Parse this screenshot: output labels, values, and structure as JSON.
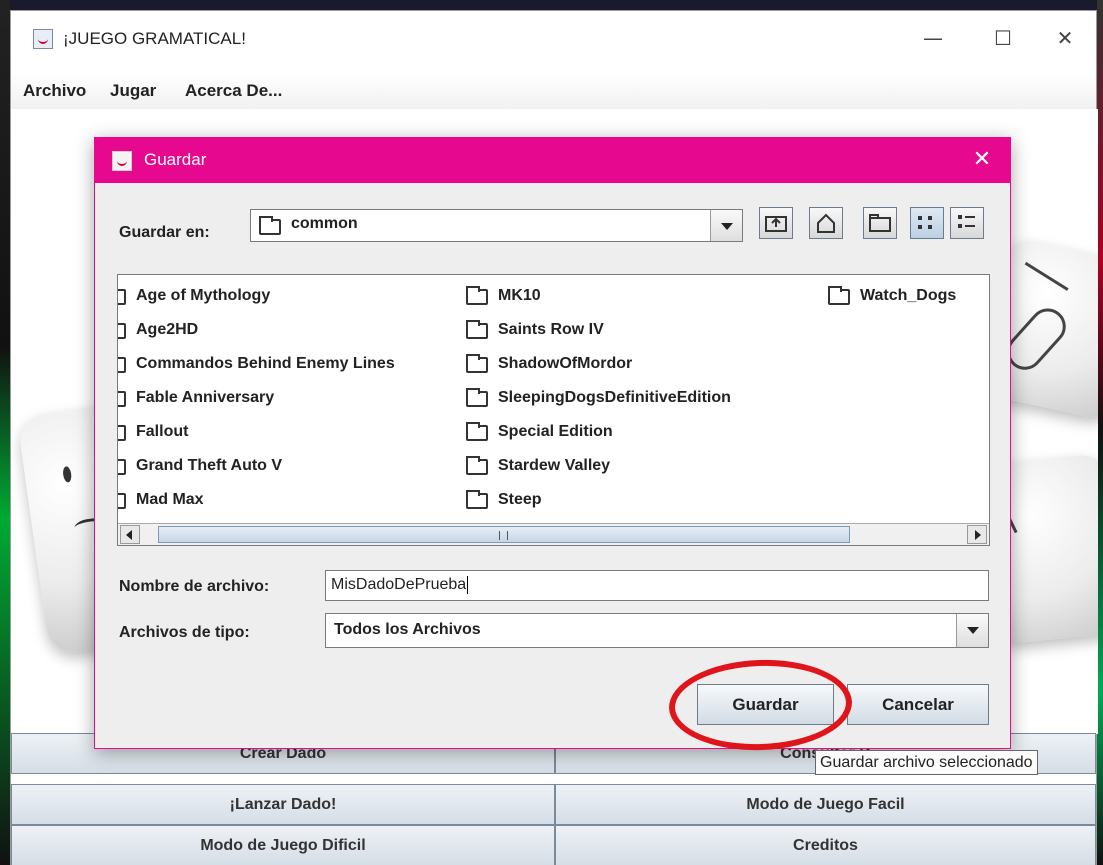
{
  "main_window": {
    "title": "¡JUEGO GRAMATICAL!",
    "controls": {
      "minimize": "—",
      "maximize": "☐",
      "close": "✕"
    },
    "menu": [
      "Archivo",
      "Jugar",
      "Acerca De..."
    ],
    "buttons": {
      "crear_dado": "Crear Dado",
      "consultar_dado": "Consultar D",
      "lanzar_dado": "¡Lanzar Dado!",
      "modo_facil": "Modo de Juego Facil",
      "modo_dificil": "Modo de Juego Dificil",
      "creditos": "Creditos"
    }
  },
  "dialog": {
    "title": "Guardar",
    "close": "✕",
    "look_in_label": "Guardar en:",
    "look_in_value": "common",
    "toolbar_icons": [
      "up-one-level-icon",
      "home-icon",
      "new-folder-icon",
      "list-view-icon",
      "details-view-icon"
    ],
    "files": [
      "Age of Mythology",
      "Age2HD",
      "Commandos Behind Enemy Lines",
      "Fable Anniversary",
      "Fallout",
      "Grand Theft Auto V",
      "Mad Max",
      "MK10",
      "Saints Row IV",
      "ShadowOfMordor",
      "SleepingDogsDefinitiveEdition",
      "Special Edition",
      "Stardew Valley",
      "Steep",
      "Watch_Dogs"
    ],
    "filename_label": "Nombre de archivo:",
    "filename_value": "MisDadoDePrueba",
    "filetype_label": "Archivos de tipo:",
    "filetype_value": "Todos los Archivos",
    "save_button": "Guardar",
    "cancel_button": "Cancelar"
  },
  "tooltip": "Guardar archivo seleccionado",
  "colors": {
    "dialog_title_bar": "#e6088e",
    "highlight_ring": "#e0141b"
  }
}
